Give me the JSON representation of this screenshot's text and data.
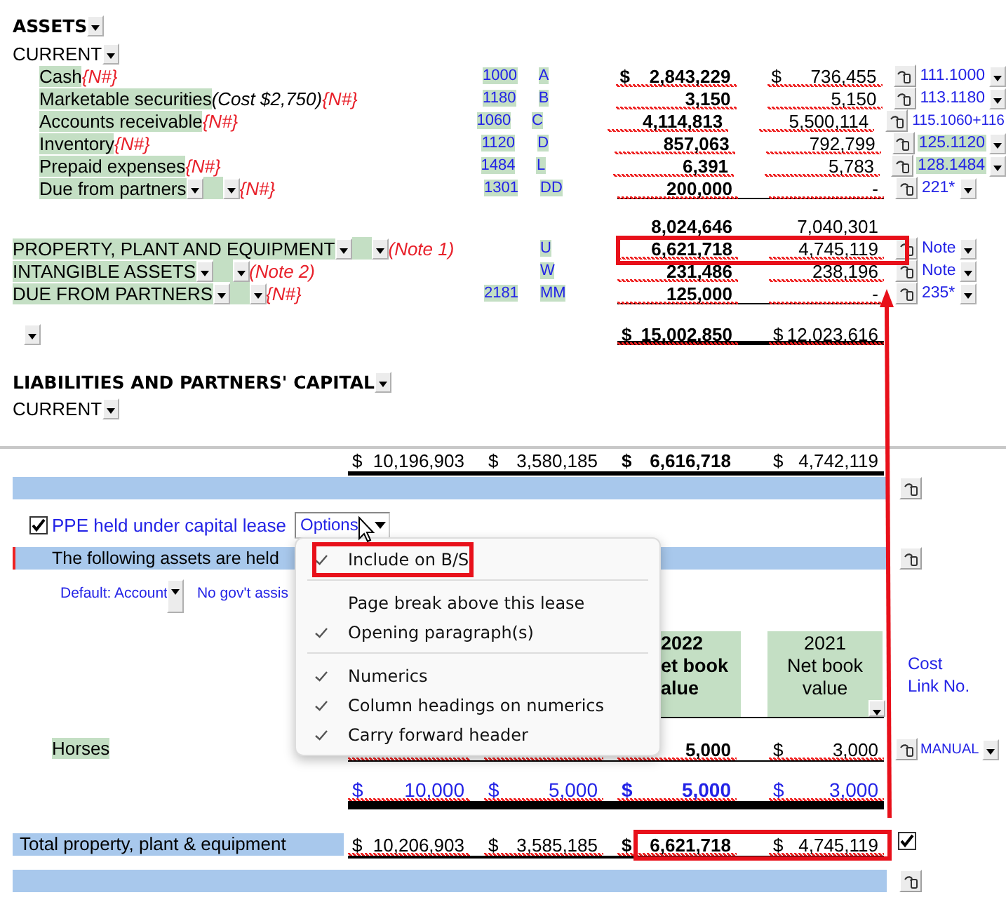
{
  "top": {
    "heading": "ASSETS",
    "subheading": "CURRENT",
    "current_rows": [
      {
        "kind": "plain",
        "label": "Cash",
        "tag": "{N#}",
        "account": "1000",
        "code": "A",
        "currency_2022": "$",
        "amount_2022": "2,843,229",
        "currency_2021": "$",
        "amount_2021": "736,455",
        "link": "111.1000",
        "link_dropdown": true,
        "link_highlighted": false
      },
      {
        "kind": "plain",
        "label": "Marketable securities",
        "note": " (Cost $2,750)",
        "tag": "{N#}",
        "account": "1180",
        "code": "B",
        "amount_2022": "3,150",
        "amount_2021": "5,150",
        "link": "113.1180",
        "link_dropdown": true,
        "link_highlighted": false
      },
      {
        "kind": "plain",
        "label": "Accounts receivable",
        "tag": "{N#}",
        "account": "1060",
        "code": "C",
        "amount_2022": "4,114,813",
        "amount_2021": "5,500,114",
        "link": "115.1060+116",
        "link_dropdown": false,
        "link_highlighted": false
      },
      {
        "kind": "plain",
        "label": "Inventory",
        "tag": "{N#}",
        "account": "1120",
        "code": "D",
        "amount_2022": "857,063",
        "amount_2021": "792,799",
        "link": "125.1120",
        "link_dropdown": true,
        "link_highlighted": true
      },
      {
        "kind": "plain",
        "label": "Prepaid expenses",
        "tag": "{N#}",
        "account": "1484",
        "code": "L",
        "amount_2022": "6,391",
        "amount_2021": "5,783",
        "link": "128.1484",
        "link_dropdown": true,
        "link_highlighted": true
      },
      {
        "kind": "dropdown",
        "label": "Due from partners",
        "tag": "{N#}",
        "account": "1301",
        "code": "DD",
        "amount_2022": "200,000",
        "amount_2021": "-",
        "link": "221*",
        "link_dropdown": true,
        "link_highlighted": false
      }
    ],
    "subtotal": {
      "amount_2022": "8,024,646",
      "amount_2021": "7,040,301"
    },
    "noncurrent_rows": [
      {
        "kind": "dropdown",
        "label": "PROPERTY, PLANT AND EQUIPMENT",
        "tag": " (Note 1)",
        "code": "U",
        "amount_2022": "6,621,718",
        "amount_2021": "4,745,119",
        "link": "Note",
        "link_dropdown": true,
        "link_highlighted": false
      },
      {
        "kind": "dropdown",
        "label": "INTANGIBLE ASSETS",
        "tag": " (Note 2)",
        "code": "W",
        "amount_2022": "231,486",
        "amount_2021": "238,196",
        "link": "Note",
        "link_dropdown": true,
        "link_highlighted": false
      },
      {
        "kind": "dropdown",
        "label": "DUE FROM PARTNERS",
        "tag": "{N#}",
        "account": "2181",
        "code": "MM",
        "amount_2022": "125,000",
        "amount_2021": "-",
        "link": "235*",
        "link_dropdown": true,
        "link_highlighted": false
      }
    ],
    "total": {
      "currency_2022": "$",
      "amount_2022": "15,002,850",
      "currency_2021": "$",
      "amount_2021": "12,023,616"
    },
    "liabilities_heading": "LIABILITIES AND PARTNERS' CAPITAL",
    "liabilities_subheading": "CURRENT"
  },
  "bottom": {
    "totals_row": [
      {
        "currency": "$",
        "amount": "10,196,903"
      },
      {
        "currency": "$",
        "amount": "3,580,185"
      },
      {
        "currency": "$",
        "amount": "6,616,718"
      },
      {
        "currency": "$",
        "amount": "4,742,119"
      }
    ],
    "lease": {
      "checked": true,
      "label": "PPE held under capital lease",
      "options_button": "Options"
    },
    "intro": "The following assets are held",
    "default_account": "Default: Account",
    "assistance": "No gov't assis",
    "headers": [
      {
        "lines": [
          "2022",
          "et book",
          "alue"
        ]
      },
      {
        "lines": [
          "2021",
          "Net book",
          "value"
        ]
      }
    ],
    "link_header": [
      "Cost",
      "Link No."
    ],
    "assets": [
      {
        "label": "Horses",
        "cells": [
          null,
          null,
          {
            "amount": "5,000"
          },
          {
            "currency": "$",
            "amount": "3,000"
          }
        ],
        "link": "MANUAL"
      }
    ],
    "subtotal": [
      {
        "currency": "$",
        "amount": "10,000"
      },
      {
        "currency": "$",
        "amount": "5,000"
      },
      {
        "currency": "$",
        "amount": "5,000"
      },
      {
        "currency": "$",
        "amount": "3,000"
      }
    ],
    "total": {
      "label": "Total property, plant & equipment",
      "checked": true,
      "cells": [
        {
          "currency": "$",
          "amount": "10,206,903"
        },
        {
          "currency": "$",
          "amount": "3,585,185"
        },
        {
          "currency": "$",
          "amount": "6,621,718"
        },
        {
          "currency": "$",
          "amount": "4,745,119"
        }
      ]
    }
  },
  "menu": {
    "sections": [
      {
        "items": [
          {
            "label": "Include on B/S",
            "checked": true
          }
        ]
      },
      {
        "items": [
          {
            "label": "Page break above this lease",
            "checked": false
          },
          {
            "label": "Opening paragraph(s)",
            "checked": true
          }
        ]
      },
      {
        "items": [
          {
            "label": "Numerics",
            "checked": true
          },
          {
            "label": "Column headings on numerics",
            "checked": true
          },
          {
            "label": "Carry forward header",
            "checked": true
          }
        ]
      }
    ]
  }
}
